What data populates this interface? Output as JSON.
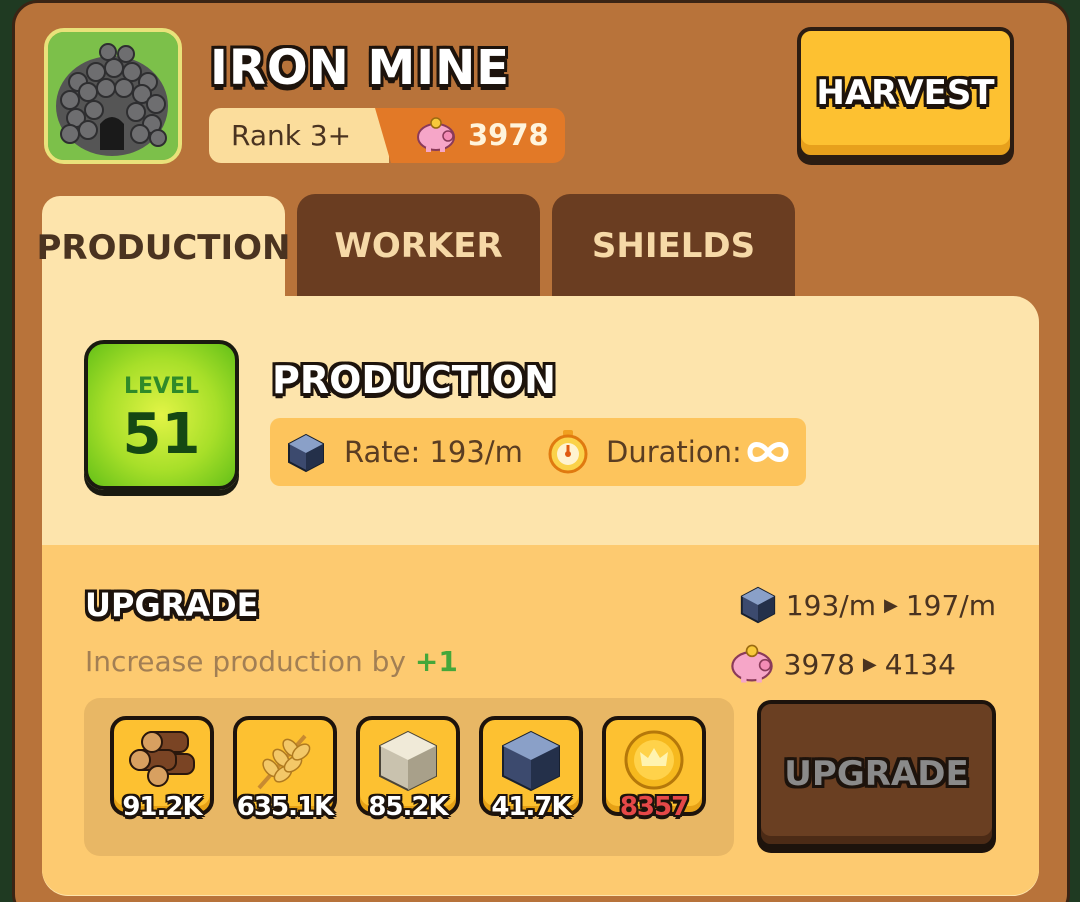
{
  "building": {
    "title": "IRON MINE",
    "rank": "Rank 3+",
    "score": "3978",
    "harvest_label": "HARVEST"
  },
  "tabs": [
    {
      "label": "PRODUCTION"
    },
    {
      "label": "WORKER"
    },
    {
      "label": "SHIELDS"
    }
  ],
  "production": {
    "level_label": "LEVEL",
    "level": "51",
    "title": "PRODUCTION",
    "rate": "Rate: 193/m",
    "duration": "Duration:"
  },
  "upgrade": {
    "title": "UPGRADE",
    "desc": "Increase production by",
    "desc_bonus": "+1",
    "rate_from": "193/m",
    "rate_to": "197/m",
    "score_from": "3978",
    "score_to": "4134",
    "button_label": "UPGRADE",
    "costs": [
      {
        "icon": "logs-icon",
        "value": "91.2K",
        "insufficient": false
      },
      {
        "icon": "wheat-icon",
        "value": "635.1K",
        "insufficient": false
      },
      {
        "icon": "stone-block-icon",
        "value": "85.2K",
        "insufficient": false
      },
      {
        "icon": "iron-cube-icon",
        "value": "41.7K",
        "insufficient": false
      },
      {
        "icon": "crown-coin-icon",
        "value": "8357",
        "insufficient": true
      }
    ]
  }
}
